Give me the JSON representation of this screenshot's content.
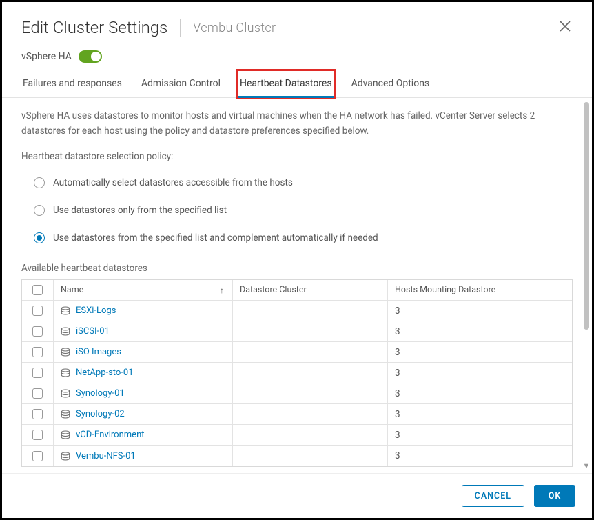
{
  "header": {
    "title": "Edit Cluster Settings",
    "subtitle": "Vembu Cluster"
  },
  "ha": {
    "label": "vSphere HA",
    "enabled": true
  },
  "tabs": [
    {
      "label": "Failures and responses",
      "active": false
    },
    {
      "label": "Admission Control",
      "active": false
    },
    {
      "label": "Heartbeat Datastores",
      "active": true,
      "highlighted": true
    },
    {
      "label": "Advanced Options",
      "active": false
    }
  ],
  "content": {
    "description": "vSphere HA uses datastores to monitor hosts and virtual machines when the HA network has failed. vCenter Server selects 2 datastores for each host using the policy and datastore preferences specified below.",
    "policy_label": "Heartbeat datastore selection policy:",
    "policies": [
      {
        "label": "Automatically select datastores accessible from the hosts",
        "selected": false
      },
      {
        "label": "Use datastores only from the specified list",
        "selected": false
      },
      {
        "label": "Use datastores from the specified list and complement automatically if needed",
        "selected": true
      }
    ],
    "available_label": "Available heartbeat datastores",
    "columns": {
      "name": "Name",
      "cluster": "Datastore Cluster",
      "hosts": "Hosts Mounting Datastore"
    },
    "datastores": [
      {
        "name": "ESXi-Logs",
        "cluster": "",
        "hosts": "3"
      },
      {
        "name": "iSCSI-01",
        "cluster": "",
        "hosts": "3"
      },
      {
        "name": "iSO Images",
        "cluster": "",
        "hosts": "3"
      },
      {
        "name": "NetApp-sto-01",
        "cluster": "",
        "hosts": "3"
      },
      {
        "name": "Synology-01",
        "cluster": "",
        "hosts": "3"
      },
      {
        "name": "Synology-02",
        "cluster": "",
        "hosts": "3"
      },
      {
        "name": "vCD-Environment",
        "cluster": "",
        "hosts": "3"
      },
      {
        "name": "Vembu-NFS-01",
        "cluster": "",
        "hosts": "3"
      }
    ]
  },
  "footer": {
    "cancel": "CANCEL",
    "ok": "OK"
  }
}
